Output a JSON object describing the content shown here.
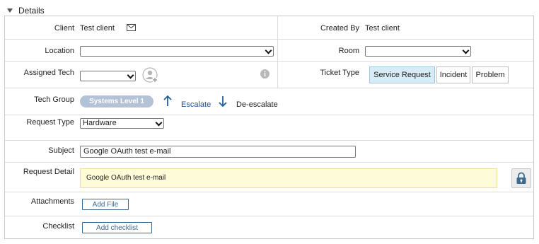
{
  "section": {
    "title": "Details"
  },
  "labels": {
    "client": "Client",
    "created_by": "Created By",
    "location": "Location",
    "room": "Room",
    "assigned_tech": "Assigned Tech",
    "ticket_type": "Ticket Type",
    "tech_group": "Tech Group",
    "request_type": "Request Type",
    "subject": "Subject",
    "request_detail": "Request Detail",
    "attachments": "Attachments",
    "checklist": "Checklist"
  },
  "values": {
    "client": "Test client",
    "created_by": "Test client",
    "location": "",
    "room": "",
    "assigned_tech": "",
    "tech_group": "Systems  Level 1",
    "request_type": "Hardware",
    "subject": "Google OAuth test e-mail",
    "request_detail": "Google OAuth test e-mail"
  },
  "ticket_types": [
    "Service Request",
    "Incident",
    "Problem"
  ],
  "tech_group_actions": {
    "escalate": "Escalate",
    "deescalate": "De-escalate"
  },
  "buttons": {
    "add_file": "Add File",
    "add_checklist": "Add checklist"
  },
  "colors": {
    "active_segment": "#d7ecf6",
    "detail_bg": "#fdfbd8",
    "pill": "#b3c2d6",
    "arrow": "#1f5f99"
  }
}
